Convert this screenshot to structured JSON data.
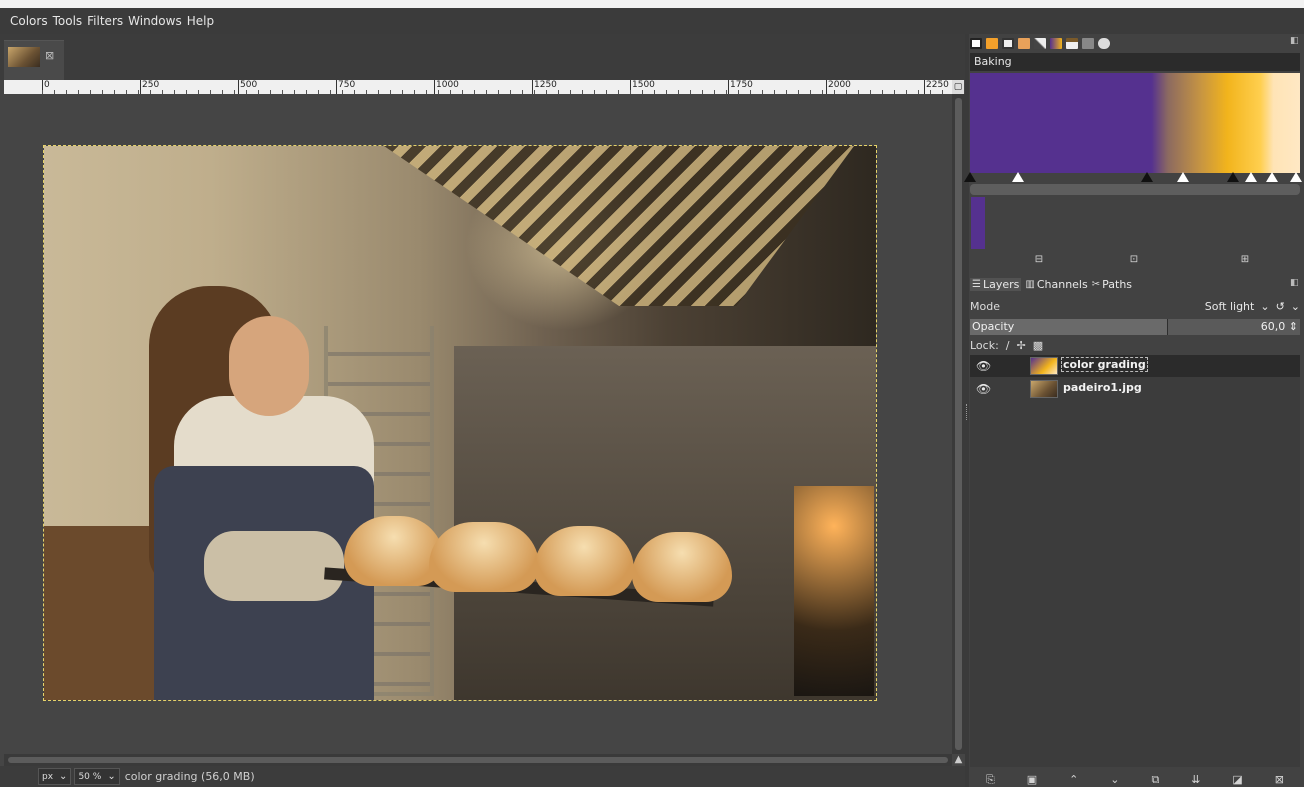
{
  "menubar": {
    "items": [
      "Colors",
      "Tools",
      "Filters",
      "Windows",
      "Help"
    ]
  },
  "image_tab": {
    "close_glyph": "⊠"
  },
  "ruler": {
    "labels": [
      "0",
      "250",
      "500",
      "750",
      "1000",
      "1250",
      "1500",
      "1750",
      "2000",
      "2250"
    ]
  },
  "statusbar": {
    "unit": "px",
    "zoom": "50 %",
    "info": "color grading (56,0 MB)"
  },
  "gradient_panel": {
    "name": "Baking",
    "colors": {
      "purple": "#55318f",
      "orange": "#f2b41c",
      "cream": "#ffe8c4"
    }
  },
  "layers_panel": {
    "tabs": [
      {
        "label": "Layers",
        "icon": "layers-icon"
      },
      {
        "label": "Channels",
        "icon": "channels-icon"
      },
      {
        "label": "Paths",
        "icon": "paths-icon"
      }
    ],
    "mode_label": "Mode",
    "mode_value": "Soft light",
    "opacity_label": "Opacity",
    "opacity_value": "60,0",
    "opacity_fraction": 0.6,
    "lock_label": "Lock:",
    "layers": [
      {
        "name": "color grading",
        "selected": true,
        "visible": true
      },
      {
        "name": "padeiro1.jpg",
        "selected": false,
        "visible": true
      }
    ]
  }
}
